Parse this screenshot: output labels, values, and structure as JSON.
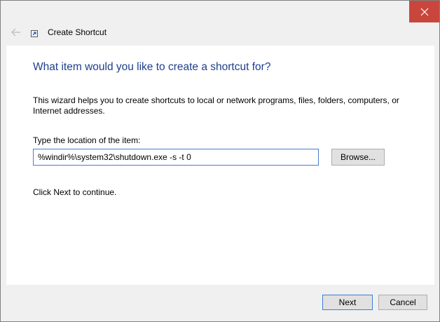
{
  "window": {
    "title": "Create Shortcut"
  },
  "page": {
    "heading": "What item would you like to create a shortcut for?",
    "description": "This wizard helps you to create shortcuts to local or network programs, files, folders, computers, or Internet addresses.",
    "location_label": "Type the location of the item:",
    "location_value": "%windir%\\system32\\shutdown.exe -s -t 0",
    "browse_label": "Browse...",
    "continue_hint": "Click Next to continue."
  },
  "footer": {
    "next_label": "Next",
    "cancel_label": "Cancel"
  },
  "icons": {
    "close": "close-icon",
    "back": "back-arrow-icon",
    "app": "shortcut-icon"
  },
  "colors": {
    "heading": "#1e3f8c",
    "close_button": "#c9463d",
    "focus_border": "#4a7bd0"
  }
}
